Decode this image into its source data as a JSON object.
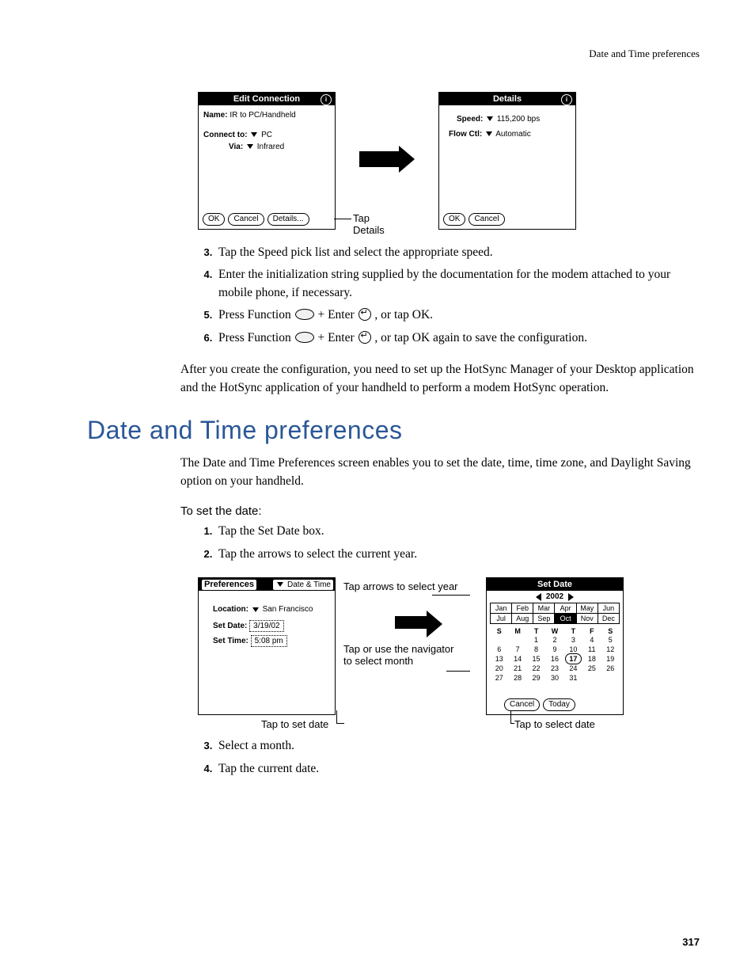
{
  "header": {
    "running": "Date and Time preferences"
  },
  "fig1": {
    "left": {
      "title": "Edit Connection",
      "name_label": "Name:",
      "name_value": "IR to PC/Handheld",
      "connect_label": "Connect to:",
      "connect_value": "PC",
      "via_label": "Via:",
      "via_value": "Infrared",
      "btn_ok": "OK",
      "btn_cancel": "Cancel",
      "btn_details": "Details..."
    },
    "callout": "Tap Details",
    "right": {
      "title": "Details",
      "speed_label": "Speed:",
      "speed_value": "115,200 bps",
      "flow_label": "Flow Ctl:",
      "flow_value": "Automatic",
      "btn_ok": "OK",
      "btn_cancel": "Cancel"
    }
  },
  "steps_a": {
    "s3": "Tap the Speed pick list and select the appropriate speed.",
    "s4": "Enter the initialization string supplied by the documentation for the modem attached to your mobile phone, if necessary.",
    "s5a": "Press Function ",
    "s5b": " + Enter ",
    "s5c": " , or tap OK.",
    "s6a": "Press Function ",
    "s6b": " + Enter ",
    "s6c": " , or tap OK again to save the configuration."
  },
  "para1": "After you create the configuration, you need to set up the HotSync Manager of your Desktop application and the HotSync application of your handheld to perform a modem HotSync operation.",
  "section_title": "Date and Time preferences",
  "para2": "The Date and Time Preferences screen enables you to set the date, time, time zone, and Daylight Saving option on your handheld.",
  "subhead": "To set the date:",
  "steps_b": {
    "s1": "Tap the Set Date box.",
    "s2": "Tap the arrows to select the current year."
  },
  "fig2": {
    "left": {
      "title": "Preferences",
      "menu": "Date & Time",
      "location_label": "Location:",
      "location_value": "San Francisco",
      "setdate_label": "Set Date:",
      "setdate_value": "3/19/02",
      "settime_label": "Set Time:",
      "settime_value": "5:08 pm"
    },
    "callouts": {
      "c1": "Tap arrows to select year",
      "c2": "Tap or use the navigator to select month",
      "c3": "Tap to set date",
      "c4": "Tap to select date"
    },
    "right": {
      "title": "Set Date",
      "year": "2002",
      "months": [
        "Jan",
        "Feb",
        "Mar",
        "Apr",
        "May",
        "Jun",
        "Jul",
        "Aug",
        "Sep",
        "Oct",
        "Nov",
        "Dec"
      ],
      "month_selected": "Oct",
      "dow": [
        "S",
        "M",
        "T",
        "W",
        "T",
        "F",
        "S"
      ],
      "days": [
        "",
        "",
        "1",
        "2",
        "3",
        "4",
        "5",
        "6",
        "7",
        "8",
        "9",
        "10",
        "11",
        "12",
        "13",
        "14",
        "15",
        "16",
        "17",
        "18",
        "19",
        "20",
        "21",
        "22",
        "23",
        "24",
        "25",
        "26",
        "27",
        "28",
        "29",
        "30",
        "31",
        "",
        ""
      ],
      "day_selected": "17",
      "btn_cancel": "Cancel",
      "btn_today": "Today"
    }
  },
  "steps_c": {
    "s3": "Select a month.",
    "s4": "Tap the current date."
  },
  "page_number": "317"
}
